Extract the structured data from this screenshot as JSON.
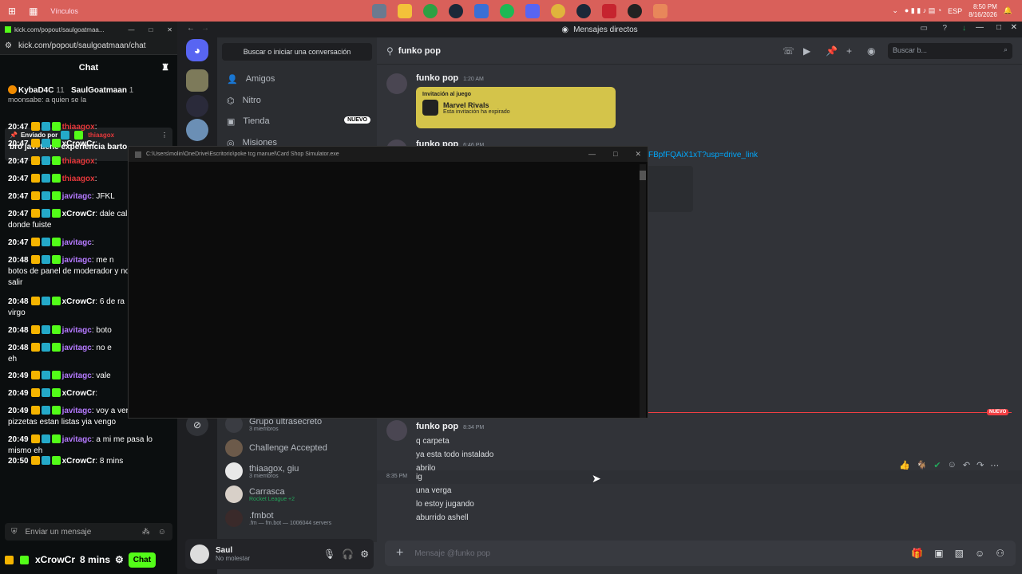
{
  "taskbar": {
    "links_label": "Vínculos",
    "lang": "ESP",
    "time": "8:50 PM",
    "date": "8/16/2026"
  },
  "kick": {
    "tab_title": "kick.com/popout/saulgoatmaa...",
    "url": "kick.com/popout/saulgoatmaan/chat",
    "header": "Chat",
    "top_users": [
      {
        "name": "KybaD4C",
        "count": "11"
      },
      {
        "name": "SaulGoatmaan",
        "count": "1"
      }
    ],
    "ticker": "moonsabe: a quien se la",
    "pinned": {
      "label": "Enviado por",
      "user": "thiaagox",
      "text": "bro javi tiene experiencia barto"
    },
    "messages": [
      {
        "time": "20:47",
        "user": "thiaagox",
        "color": "#e5383b",
        "text": ":"
      },
      {
        "time": "20:47",
        "user": "xCrowCr",
        "color": "#ffffff",
        "text": ":"
      },
      {
        "time": "20:47",
        "user": "thiaagox",
        "color": "#e5383b",
        "text": ":"
      },
      {
        "time": "20:47",
        "user": "thiaagox",
        "color": "#e5383b",
        "text": ":"
      },
      {
        "time": "20:47",
        "user": "javitagc",
        "color": "#b57aff",
        "text": ": JFKL"
      },
      {
        "time": "20:47",
        "user": "xCrowCr",
        "color": "#ffffff",
        "text": ": dale cal",
        "cont": "donde fuiste"
      },
      {
        "time": "20:47",
        "user": "javitagc",
        "color": "#b57aff",
        "text": ":"
      },
      {
        "time": "20:48",
        "user": "javitagc",
        "color": "#b57aff",
        "text": ": me n",
        "cont": "botos de panel de moderador y no",
        "cont2": "salir"
      },
      {
        "time": "20:48",
        "user": "xCrowCr",
        "color": "#ffffff",
        "text": ": 6 de ra",
        "cont": "virgo"
      },
      {
        "time": "20:48",
        "user": "javitagc",
        "color": "#b57aff",
        "text": ": boto"
      },
      {
        "time": "20:48",
        "user": "javitagc",
        "color": "#b57aff",
        "text": ": no e",
        "cont": "eh"
      },
      {
        "time": "20:49",
        "user": "javitagc",
        "color": "#b57aff",
        "text": ": vale"
      },
      {
        "time": "20:49",
        "user": "xCrowCr",
        "color": "#ffffff",
        "text": ":"
      },
      {
        "time": "20:49",
        "user": "javitagc",
        "color": "#b57aff",
        "text": ": voy a ver si mis",
        "cont": "pizzetas estan listas yia vengo"
      },
      {
        "time": "20:49",
        "user": "javitagc",
        "color": "#b57aff",
        "text": ": a mi me pasa lo",
        "cont": "mismo eh"
      },
      {
        "time": "20:50",
        "user": "xCrowCr",
        "color": "#ffffff",
        "text": ": 8 mins"
      }
    ],
    "input_placeholder": "Enviar un mensaje",
    "footer_user": "xCrowCr",
    "footer_text": "8 mins",
    "chat_button": "Chat"
  },
  "discord": {
    "window_title": "Mensajes directos",
    "search_conv": "Buscar o iniciar una conversación",
    "nav": [
      {
        "label": "Amigos"
      },
      {
        "label": "Nitro"
      },
      {
        "label": "Tienda",
        "badge": "NUEVO"
      },
      {
        "label": "Misiones"
      }
    ],
    "dms": [
      {
        "name": "Grupo ultrasecreto",
        "sub": "3 miembros"
      },
      {
        "name": "Challenge Accepted",
        "sub": ""
      },
      {
        "name": "thiaagox, giu",
        "sub": "3 miembros"
      },
      {
        "name": "Carrasca",
        "sub": "Rocket League +2"
      },
      {
        "name": ".fmbot",
        "sub": ".fm — fm.bot — 1006044 servers"
      }
    ],
    "user": {
      "name": "Saul",
      "status": "No molestar"
    },
    "channel": "funko pop",
    "search_placeholder": "Buscar b...",
    "msg1": {
      "author": "funko pop",
      "time": "1:20 AM",
      "invite_label": "Invitación al juego",
      "game": "Marvel Rivals",
      "expired": "Esta invitación ha expirado"
    },
    "msg2": {
      "author": "funko pop",
      "time": "6:46 PM",
      "link": "FBpfFQAiX1xT?usp=drive_link"
    },
    "new_label": "NUEVO",
    "msg3": {
      "author": "funko pop",
      "time": "8:34 PM",
      "lines": [
        "q carpeta",
        "ya esta todo instalado",
        "abrilo"
      ]
    },
    "msg4": {
      "time": "8:35 PM",
      "lines": [
        "ig",
        "una verga",
        "lo estoy jugando",
        "aburrido ashell"
      ]
    },
    "input_placeholder": "Mensaje @funko pop"
  },
  "terminal": {
    "title": "C:\\Users\\molin\\OneDrive\\Escritorio\\poke tcg manuel\\Card Shop Simulator.exe"
  }
}
